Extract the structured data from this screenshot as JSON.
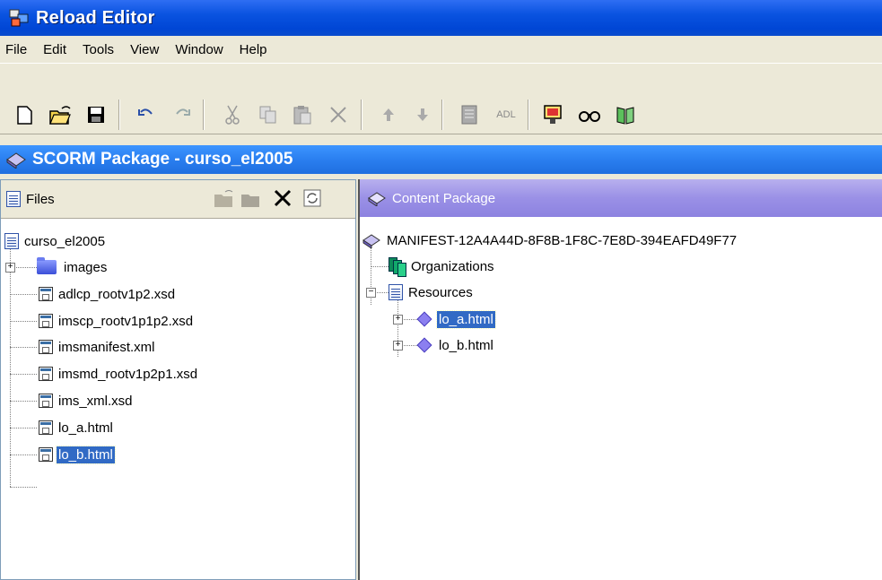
{
  "window": {
    "title": "Reload Editor"
  },
  "menu": [
    "File",
    "Edit",
    "Tools",
    "View",
    "Window",
    "Help"
  ],
  "toolbar": {
    "buttons": [
      "new-icon",
      "open-icon",
      "save-icon",
      "undo-icon",
      "redo-icon",
      "cut-icon",
      "copy-icon",
      "paste-icon",
      "delete-icon",
      "move-up-icon",
      "move-down-icon",
      "metadata-icon",
      "adl-icon",
      "preview-icon",
      "view-icon",
      "book-icon"
    ],
    "adl_label": "ADL"
  },
  "document": {
    "title": "SCORM Package - curso_el2005"
  },
  "files_panel": {
    "header": "Files",
    "root": "curso_el2005",
    "items": [
      {
        "name": "images",
        "type": "folder"
      },
      {
        "name": "adlcp_rootv1p2.xsd",
        "type": "file"
      },
      {
        "name": "imscp_rootv1p1p2.xsd",
        "type": "file"
      },
      {
        "name": "imsmanifest.xml",
        "type": "file"
      },
      {
        "name": "imsmd_rootv1p2p1.xsd",
        "type": "file"
      },
      {
        "name": "ims_xml.xsd",
        "type": "file"
      },
      {
        "name": "lo_a.html",
        "type": "file"
      },
      {
        "name": "lo_b.html",
        "type": "file",
        "selected": true
      }
    ]
  },
  "content_panel": {
    "header": "Content Package",
    "manifest": "MANIFEST-12A4A44D-8F8B-1F8C-7E8D-394EAFD49F77",
    "organizations": "Organizations",
    "resources": "Resources",
    "resource_items": [
      {
        "name": "lo_a.html",
        "selected": true
      },
      {
        "name": "lo_b.html"
      }
    ]
  }
}
